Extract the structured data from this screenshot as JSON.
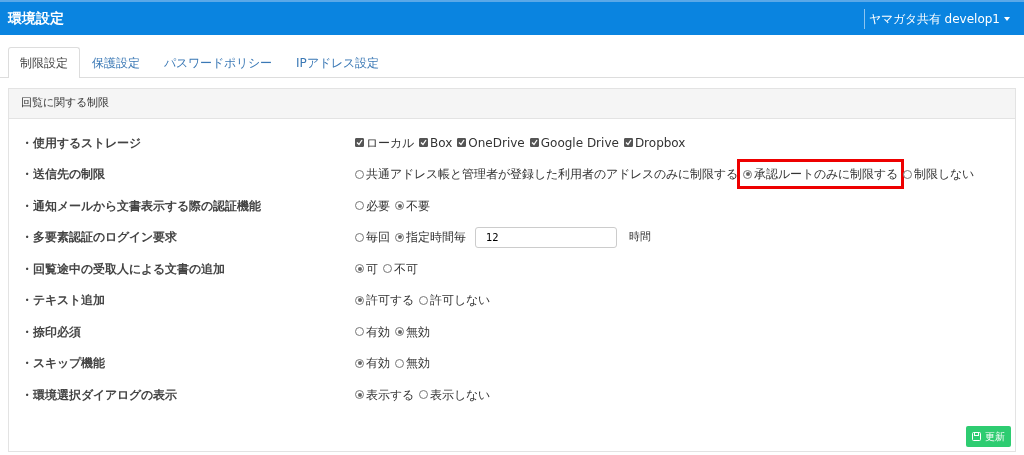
{
  "header": {
    "title": "環境設定",
    "user_menu": "ヤマガタ共有 develop1"
  },
  "tabs": [
    {
      "label": "制限設定",
      "selected": true
    },
    {
      "label": "保護設定",
      "selected": false
    },
    {
      "label": "パスワードポリシー",
      "selected": false
    },
    {
      "label": "IPアドレス設定",
      "selected": false
    }
  ],
  "panel": {
    "title": "回覧に関する制限",
    "settings": [
      {
        "label": "・使用するストレージ",
        "kind": "checkbox",
        "options": [
          {
            "label": "ローカル",
            "checked": true
          },
          {
            "label": "Box",
            "checked": true
          },
          {
            "label": "OneDrive",
            "checked": true
          },
          {
            "label": "Google Drive",
            "checked": true
          },
          {
            "label": "Dropbox",
            "checked": true
          }
        ]
      },
      {
        "label": "・送信先の制限",
        "kind": "radio",
        "options": [
          {
            "label": "共通アドレス帳と管理者が登録した利用者のアドレスのみに制限する",
            "selected": false,
            "highlighted": false
          },
          {
            "label": "承認ルートのみに制限する",
            "selected": true,
            "highlighted": true
          },
          {
            "label": "制限しない",
            "selected": false,
            "highlighted": false
          }
        ]
      },
      {
        "label": "・通知メールから文書表示する際の認証機能",
        "kind": "radio",
        "options": [
          {
            "label": "必要",
            "selected": false
          },
          {
            "label": "不要",
            "selected": true
          }
        ]
      },
      {
        "label": "・多要素認証のログイン要求",
        "kind": "radio_input",
        "options": [
          {
            "label": "毎回",
            "selected": false
          },
          {
            "label": "指定時間毎",
            "selected": true
          }
        ],
        "value": "12",
        "unit": "時間"
      },
      {
        "label": "・回覧途中の受取人による文書の追加",
        "kind": "radio",
        "options": [
          {
            "label": "可",
            "selected": true
          },
          {
            "label": "不可",
            "selected": false
          }
        ]
      },
      {
        "label": "・テキスト追加",
        "kind": "radio",
        "options": [
          {
            "label": "許可する",
            "selected": true
          },
          {
            "label": "許可しない",
            "selected": false
          }
        ]
      },
      {
        "label": "・捺印必須",
        "kind": "radio",
        "options": [
          {
            "label": "有効",
            "selected": false
          },
          {
            "label": "無効",
            "selected": true
          }
        ]
      },
      {
        "label": "・スキップ機能",
        "kind": "radio",
        "options": [
          {
            "label": "有効",
            "selected": true
          },
          {
            "label": "無効",
            "selected": false
          }
        ]
      },
      {
        "label": "・環境選択ダイアログの表示",
        "kind": "radio",
        "options": [
          {
            "label": "表示する",
            "selected": true
          },
          {
            "label": "表示しない",
            "selected": false
          }
        ]
      }
    ],
    "update_button": "更新"
  }
}
